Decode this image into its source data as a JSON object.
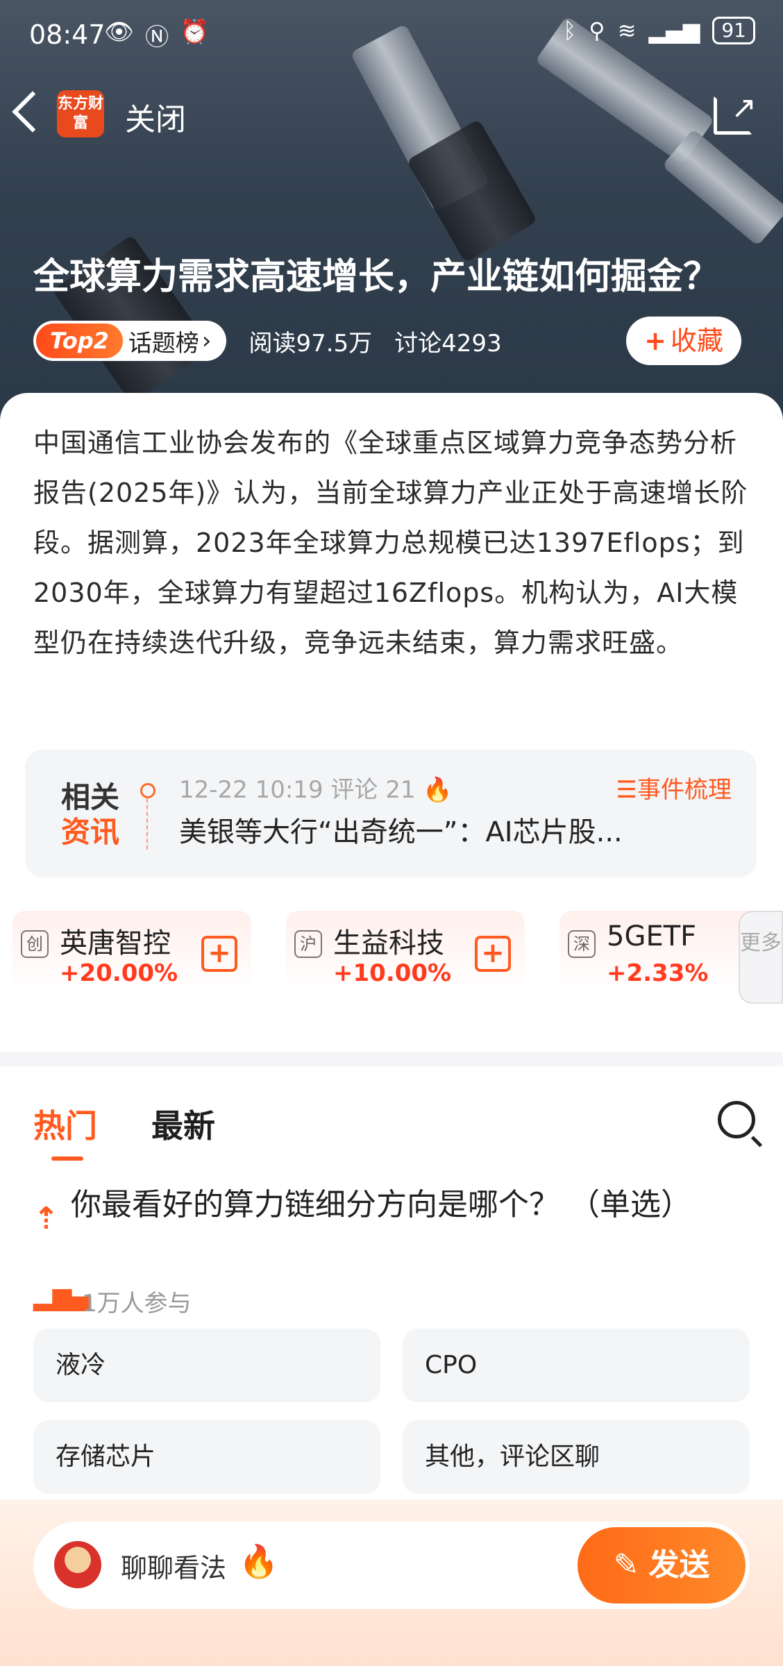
{
  "status_bar": {
    "time": "08:47",
    "battery": "91"
  },
  "top_bar": {
    "logo_text": "东方财富",
    "close_label": "关闭"
  },
  "topic": {
    "title": "全球算力需求高速增长，产业链如何掘金？",
    "rank_badge": "Top2",
    "rank_label": "话题榜",
    "reads": "阅读97.5万",
    "discussions": "讨论4293",
    "collect_label": "收藏",
    "summary": "中国通信工业协会发布的《全球重点区域算力竞争态势分析报告(2025年)》认为，当前全球算力产业正处于高速增长阶段。据测算，2023年全球算力总规模已达1397Eflops；到2030年，全球算力有望超过16Zflops。机构认为，AI大模型仍在持续迭代升级，竞争远未结束，算力需求旺盛。"
  },
  "news": {
    "logo_line1": "相关",
    "logo_line2": "资讯",
    "meta": "12-22 10:19 评论 21",
    "events_label": "事件梳理",
    "headline": "美银等大行“出奇统一”：AI芯片股..."
  },
  "stocks": [
    {
      "exchange": "创",
      "name": "英唐智控",
      "change": "+20.00%"
    },
    {
      "exchange": "沪",
      "name": "生益科技",
      "change": "+10.00%"
    },
    {
      "exchange": "深",
      "name": "5GETF",
      "change": "+2.33%"
    }
  ],
  "more_label": "更多",
  "tabs": [
    "热门",
    "最新"
  ],
  "poll": {
    "question": "你最看好的算力链细分方向是哪个？ （单选）",
    "participants": "1万人参与",
    "options": [
      "液冷",
      "CPO",
      "存储芯片",
      "其他，评论区聊"
    ]
  },
  "composer": {
    "placeholder": "聊聊看法",
    "send_label": "发送"
  },
  "colors": {
    "accent": "#ff5a1f",
    "gain": "#ff3b1f"
  }
}
